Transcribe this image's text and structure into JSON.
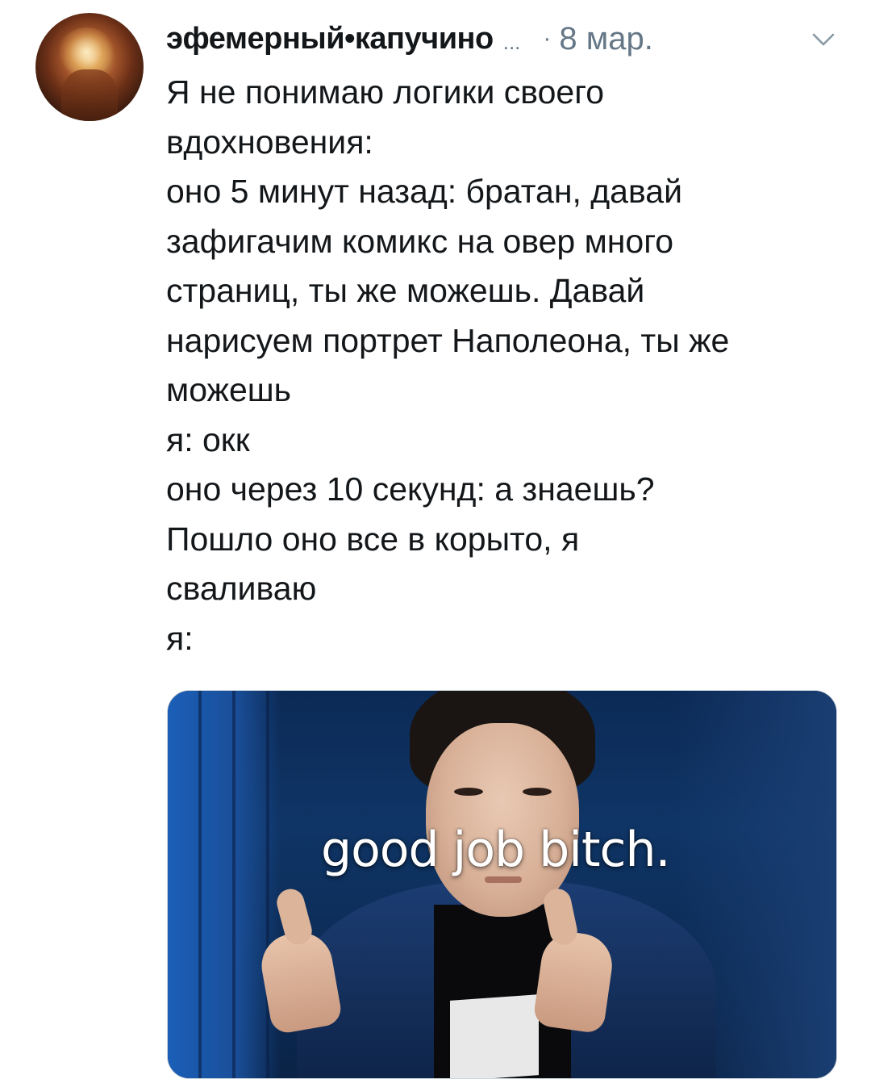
{
  "tweet": {
    "author_name": "эфемерный•капучино",
    "name_overflow": "...",
    "separator": "·",
    "date": "8 мар.",
    "menu_icon": "chevron-down-icon",
    "body_lines": [
      "Я не понимаю логики своего",
      "вдохновения:",
      "оно 5 минут назад: братан, давай",
      "зафигачим комикс на овер много",
      "страниц, ты же можешь. Давай",
      "нарисуем портрет Наполеона, ты же",
      "можешь",
      "я: окк",
      "оно через 10 секунд: а знаешь?",
      "Пошло оно все в корыто, я",
      "сваливаю",
      "я:"
    ],
    "media": {
      "caption": "good job bitch."
    }
  },
  "colors": {
    "text": "#14171a",
    "secondary": "#657786",
    "border": "#ccd6dd"
  }
}
